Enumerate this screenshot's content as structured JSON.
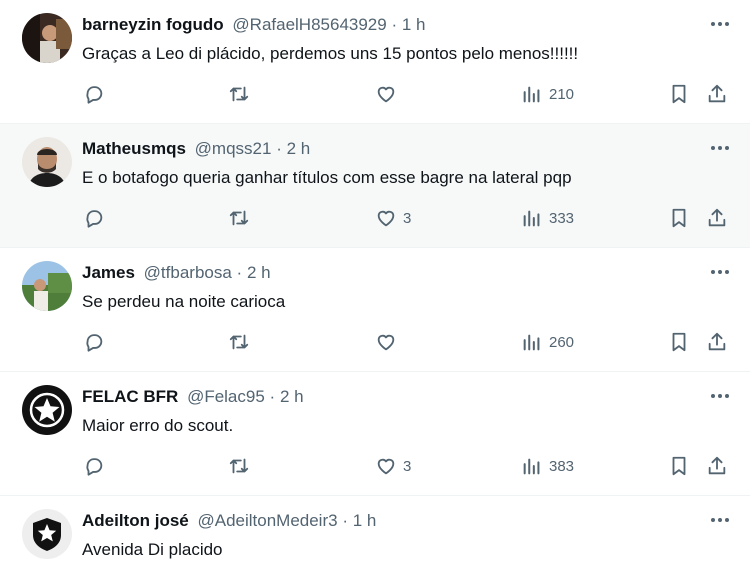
{
  "tweets": [
    {
      "name": "barneyzin fogudo",
      "handle": "@RafaelH85643929",
      "separator": "·",
      "time": "1 h",
      "text": "Graças a Leo di plácido, perdemos uns 15 pontos pelo menos!!!!!!",
      "likes": "",
      "views": "210"
    },
    {
      "name": "Matheusmqs",
      "handle": "@mqss21",
      "separator": "·",
      "time": "2 h",
      "text": "E o botafogo queria ganhar títulos com esse bagre na lateral pqp",
      "likes": "3",
      "views": "333"
    },
    {
      "name": "James",
      "handle": "@tfbarbosa",
      "separator": "·",
      "time": "2 h",
      "text": "Se perdeu na noite carioca",
      "likes": "",
      "views": "260"
    },
    {
      "name": "FELAC BFR",
      "handle": "@Felac95",
      "separator": "·",
      "time": "2 h",
      "text": "Maior erro do scout.",
      "likes": "3",
      "views": "383"
    },
    {
      "name": "Adeilton josé",
      "handle": "@AdeiltonMedeir3",
      "separator": "·",
      "time": "1 h",
      "text": "Avenida Di placido"
    }
  ],
  "icons": {
    "reply": "reply-icon",
    "retweet": "retweet-icon",
    "like": "heart-icon",
    "views": "views-icon",
    "bookmark": "bookmark-icon",
    "share": "share-icon",
    "more": "more-icon"
  },
  "colors": {
    "text": "#0f1419",
    "secondary": "#536471",
    "highlight_bg": "#f7f9f9",
    "divider": "#eff3f4"
  }
}
